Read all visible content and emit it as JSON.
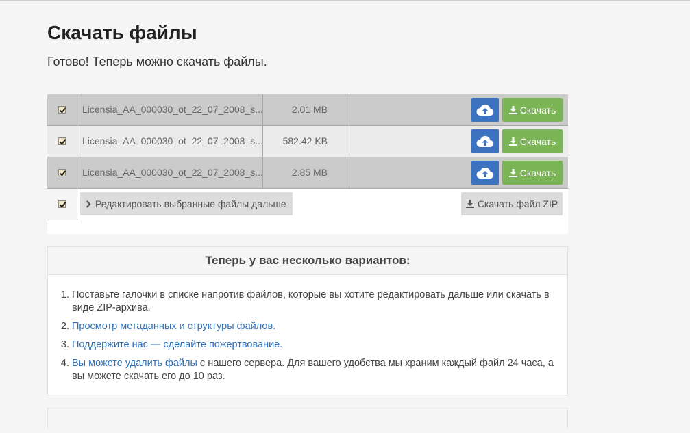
{
  "page": {
    "title": "Скачать файлы",
    "subtitle": "Готово! Теперь можно скачать файлы."
  },
  "files": [
    {
      "name": "Licensia_AA_000030_ot_22_07_2008_s...",
      "size": "2.01 MB",
      "checked": true,
      "download_label": "Скачать",
      "cloud_icon": "cloud-upload-icon"
    },
    {
      "name": "Licensia_AA_000030_ot_22_07_2008_s...",
      "size": "582.42 KB",
      "checked": true,
      "download_label": "Скачать",
      "cloud_icon": "cloud-upload-icon"
    },
    {
      "name": "Licensia_AA_000030_ot_22_07_2008_s...",
      "size": "2.85 MB",
      "checked": true,
      "download_label": "Скачать",
      "cloud_icon": "cloud-upload-icon"
    }
  ],
  "actions": {
    "select_all_checked": true,
    "edit_label": "Редактировать выбранные файлы дальше",
    "zip_label": "Скачать файл ZIP"
  },
  "options": {
    "header": "Теперь у вас несколько вариантов:",
    "item1": "Поставьте галочки в списке напротив файлов, которые вы хотите редактировать дальше или скачать в виде ZIP-архива.",
    "item2_link": "Просмотр метаданных и структуры файлов.",
    "item3_link": "Поддержите нас — сделайте пожертвование.",
    "item4_link": "Вы можете удалить файлы",
    "item4_rest": " с нашего сервера. Для вашего удобства мы храним каждый файл 24 часа, а вы можете скачать его до 10 раз."
  },
  "colors": {
    "cloud_button": "#3b73c0",
    "download_button": "#7cb556",
    "link": "#2f6fb7"
  }
}
